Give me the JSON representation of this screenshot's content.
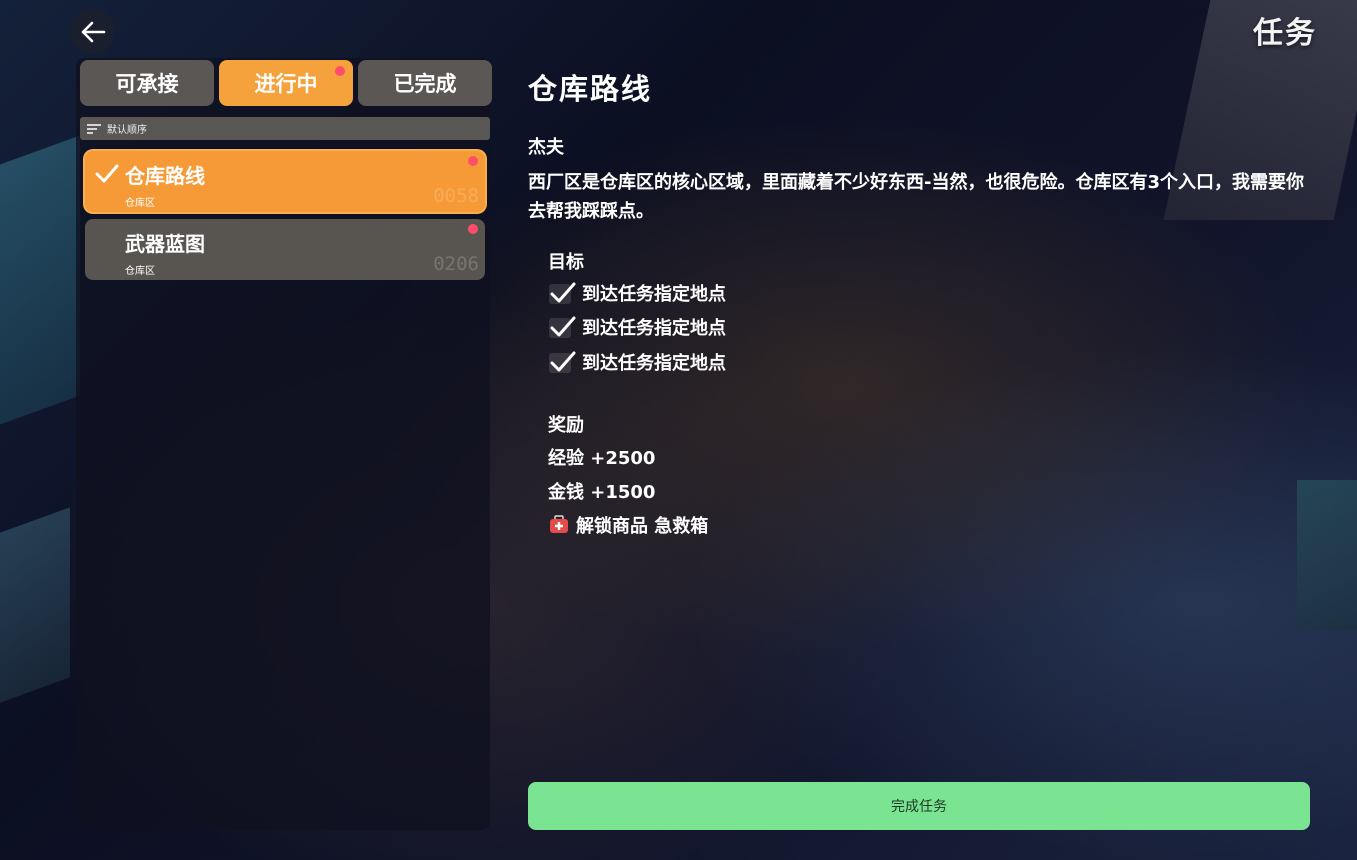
{
  "header": {
    "title": "任务",
    "back_icon": "arrow-left-icon"
  },
  "tabs": [
    {
      "label": "可承接",
      "active": false,
      "has_dot": false
    },
    {
      "label": "进行中",
      "active": true,
      "has_dot": true
    },
    {
      "label": "已完成",
      "active": false,
      "has_dot": false
    }
  ],
  "sort": {
    "label": "默认顺序",
    "icon": "sort-icon"
  },
  "quests": [
    {
      "name": "仓库路线",
      "area": "仓库区",
      "number": "0058",
      "selected": true,
      "checked": true,
      "has_dot": true
    },
    {
      "name": "武器蓝图",
      "area": "仓库区",
      "number": "0206",
      "selected": false,
      "checked": false,
      "has_dot": true
    }
  ],
  "detail": {
    "title": "仓库路线",
    "npc": "杰夫",
    "description": "西厂区是仓库区的核心区域，里面藏着不少好东西-当然，也很危险。仓库区有3个入口，我需要你去帮我踩踩点。",
    "objectives_label": "目标",
    "objectives": [
      {
        "text": "到达任务指定地点",
        "done": true
      },
      {
        "text": "到达任务指定地点",
        "done": true
      },
      {
        "text": "到达任务指定地点",
        "done": true
      }
    ],
    "rewards_label": "奖励",
    "rewards": [
      {
        "text": "经验 +2500"
      },
      {
        "text": "金钱 +1500"
      },
      {
        "text": "解锁商品 急救箱",
        "icon": "first-aid-kit-icon"
      }
    ],
    "complete_button": "完成任务"
  },
  "colors": {
    "accent": "#f5a13c",
    "complete": "#7be493",
    "notify_dot": "#ff4d6a",
    "tab_inactive": "#5a5754"
  }
}
